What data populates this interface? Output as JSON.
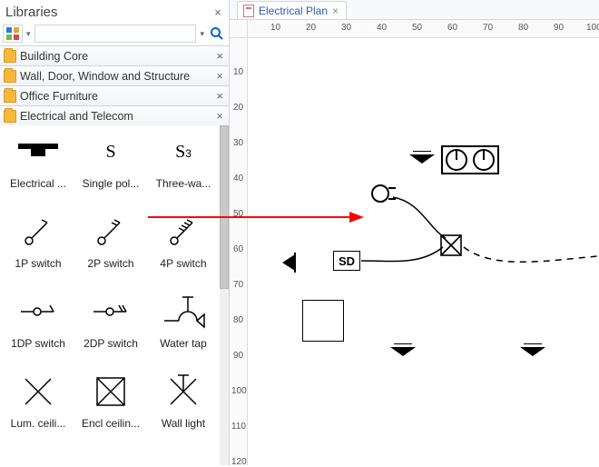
{
  "panel": {
    "title": "Libraries",
    "close": "×",
    "search_placeholder": "",
    "categories": [
      {
        "label": "Building Core",
        "close": "×"
      },
      {
        "label": "Wall, Door, Window and Structure",
        "close": "×"
      },
      {
        "label": "Office Furniture",
        "close": "×"
      },
      {
        "label": "Electrical and Telecom",
        "close": "×"
      }
    ],
    "shapes": [
      {
        "label": "Electrical ..."
      },
      {
        "label": "Single pol..."
      },
      {
        "label": "Three-wa..."
      },
      {
        "label": "1P switch"
      },
      {
        "label": "2P switch"
      },
      {
        "label": "4P switch"
      },
      {
        "label": "1DP switch"
      },
      {
        "label": "2DP switch"
      },
      {
        "label": "Water tap"
      },
      {
        "label": "Lum. ceili..."
      },
      {
        "label": "Encl ceilin..."
      },
      {
        "label": "Wall light"
      }
    ]
  },
  "tab": {
    "title": "Electrical Plan",
    "close": "×"
  },
  "ruler": {
    "h": [
      "10",
      "20",
      "30",
      "40",
      "50",
      "60",
      "70",
      "80",
      "90",
      "100"
    ],
    "v": [
      "10",
      "20",
      "30",
      "40",
      "50",
      "60",
      "70",
      "80",
      "90",
      "100",
      "110",
      "120"
    ]
  },
  "canvas": {
    "sd_label": "SD"
  }
}
